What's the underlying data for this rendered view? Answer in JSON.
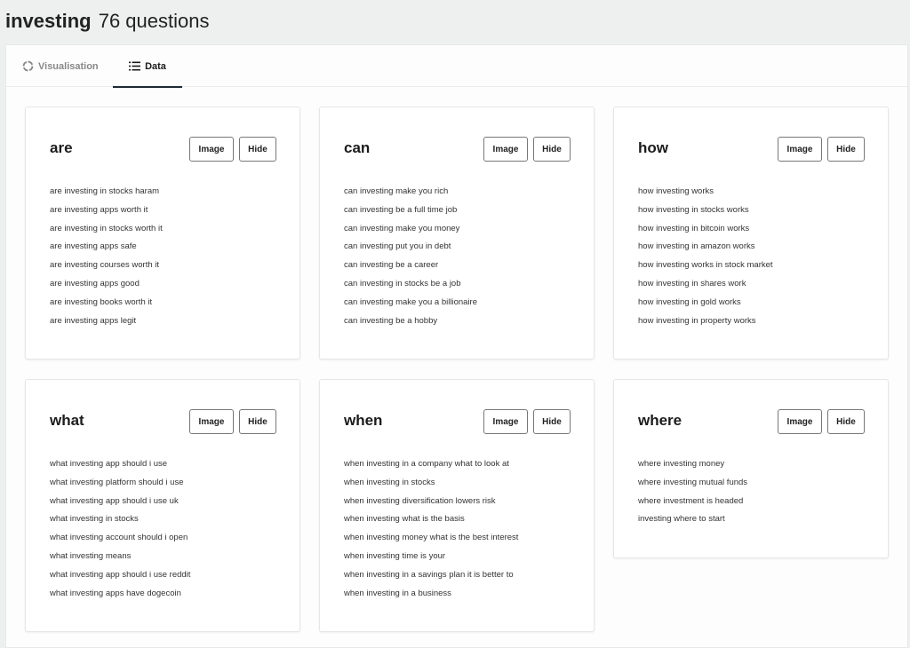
{
  "header": {
    "keyword": "investing",
    "count_label": "76 questions"
  },
  "tabs": [
    {
      "label": "Visualisation",
      "icon": "circle-loading-icon",
      "active": false
    },
    {
      "label": "Data",
      "icon": "list-icon",
      "active": true
    }
  ],
  "buttons": {
    "image_label": "Image",
    "hide_label": "Hide"
  },
  "cards": [
    {
      "title": "are",
      "questions": [
        "are investing in stocks haram",
        "are investing apps worth it",
        "are investing in stocks worth it",
        "are investing apps safe",
        "are investing courses worth it",
        "are investing apps good",
        "are investing books worth it",
        "are investing apps legit"
      ]
    },
    {
      "title": "can",
      "questions": [
        "can investing make you rich",
        "can investing be a full time job",
        "can investing make you money",
        "can investing put you in debt",
        "can investing be a career",
        "can investing in stocks be a job",
        "can investing make you a billionaire",
        "can investing be a hobby"
      ]
    },
    {
      "title": "how",
      "questions": [
        "how investing works",
        "how investing in stocks works",
        "how investing in bitcoin works",
        "how investing in amazon works",
        "how investing works in stock market",
        "how investing in shares work",
        "how investing in gold works",
        "how investing in property works"
      ]
    },
    {
      "title": "what",
      "questions": [
        "what investing app should i use",
        "what investing platform should i use",
        "what investing app should i use uk",
        "what investing in stocks",
        "what investing account should i open",
        "what investing means",
        "what investing app should i use reddit",
        "what investing apps have dogecoin"
      ]
    },
    {
      "title": "when",
      "questions": [
        "when investing in a company what to look at",
        "when investing in stocks",
        "when investing diversification lowers risk",
        "when investing what is the basis",
        "when investing money what is the best interest",
        "when investing time is your",
        "when investing in a savings plan it is better to",
        "when investing in a business"
      ]
    },
    {
      "title": "where",
      "questions": [
        "where investing money",
        "where investing mutual funds",
        "where investment is headed",
        "investing where to start"
      ]
    }
  ]
}
